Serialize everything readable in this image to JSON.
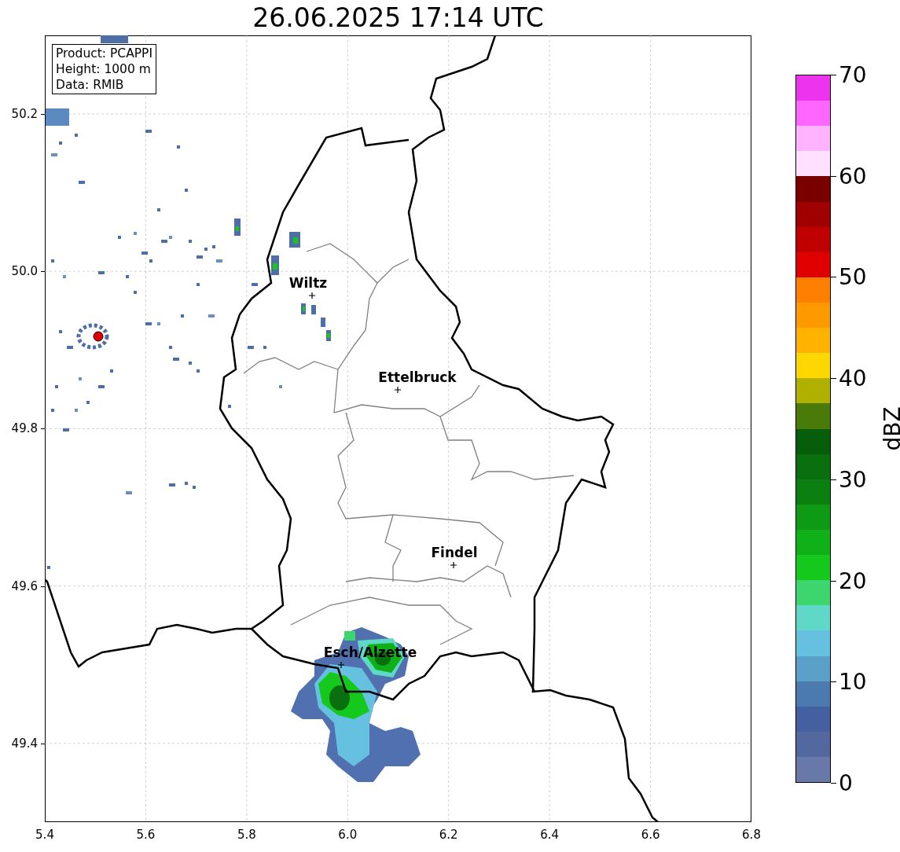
{
  "title": "26.06.2025 17:14 UTC",
  "info_box": {
    "lines": [
      "Product: PCAPPI",
      "Height: 1000 m",
      "Data: RMIB"
    ]
  },
  "map": {
    "cities": [
      "Wiltz",
      "Ettelbruck",
      "Findel",
      "Esch/Alzette"
    ],
    "x_ticks": [
      "5.4",
      "5.6",
      "5.8",
      "6.0",
      "6.2",
      "6.4",
      "6.6",
      "6.8"
    ],
    "y_ticks": [
      "50.2",
      "50.0",
      "49.8",
      "49.6",
      "49.4"
    ]
  },
  "colorbar": {
    "label": "dBZ",
    "ticks": [
      "70",
      "60",
      "50",
      "40",
      "30",
      "20",
      "10",
      "0"
    ],
    "bins": [
      {
        "color": "#ee33ee"
      },
      {
        "color": "#ff66ff"
      },
      {
        "color": "#ffb3ff"
      },
      {
        "color": "#ffe0ff"
      },
      {
        "color": "#7a0000"
      },
      {
        "color": "#a00000"
      },
      {
        "color": "#c00000"
      },
      {
        "color": "#e00000"
      },
      {
        "color": "#ff7f00"
      },
      {
        "color": "#ff9900"
      },
      {
        "color": "#ffb300"
      },
      {
        "color": "#ffd700"
      },
      {
        "color": "#b0b000"
      },
      {
        "color": "#4a7a0a"
      },
      {
        "color": "#075e0a"
      },
      {
        "color": "#0a700f"
      },
      {
        "color": "#0b8011"
      },
      {
        "color": "#0e9a14"
      },
      {
        "color": "#10b018"
      },
      {
        "color": "#14c81c"
      },
      {
        "color": "#3dd66e"
      },
      {
        "color": "#60d8c8"
      },
      {
        "color": "#66c0e0"
      },
      {
        "color": "#5aa0c8"
      },
      {
        "color": "#4a7ab0"
      },
      {
        "color": "#4460a0"
      },
      {
        "color": "#5468a0"
      },
      {
        "color": "#6878a8"
      }
    ]
  }
}
